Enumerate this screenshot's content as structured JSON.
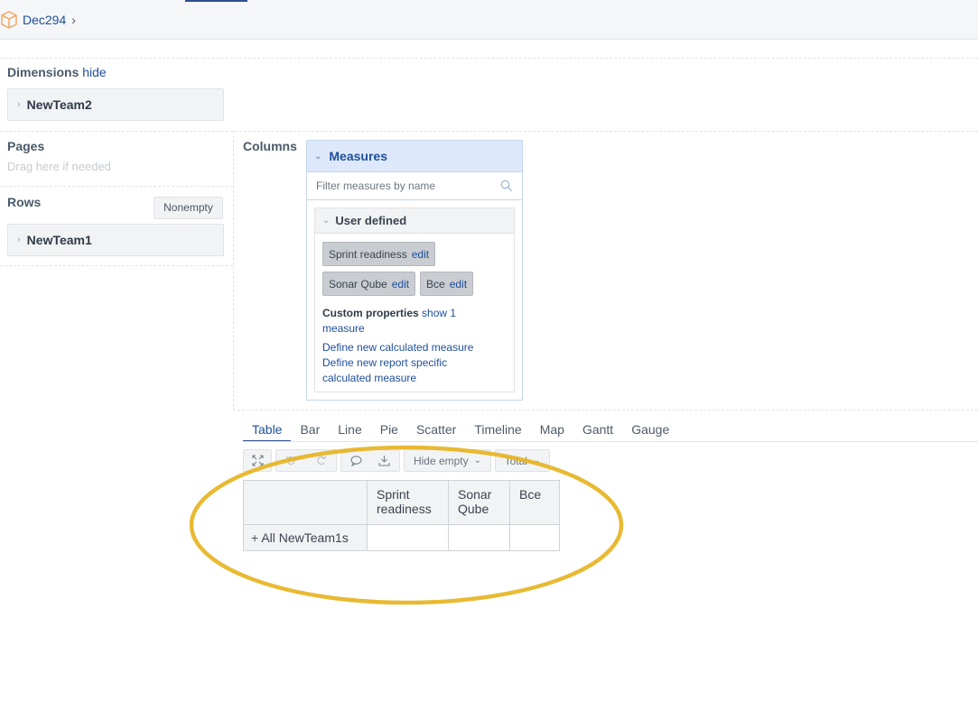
{
  "breadcrumb": {
    "label": "Dec294"
  },
  "dimensions": {
    "label": "Dimensions",
    "hide_link": "hide",
    "items": [
      {
        "label": "NewTeam2"
      }
    ]
  },
  "pages": {
    "label": "Pages",
    "hint": "Drag here if needed"
  },
  "rows": {
    "label": "Rows",
    "nonempty_button": "Nonempty",
    "items": [
      {
        "label": "NewTeam1"
      }
    ]
  },
  "columns": {
    "label": "Columns",
    "measures": {
      "title": "Measures",
      "filter_placeholder": "Filter measures by name",
      "group": {
        "title": "User defined",
        "chips": [
          {
            "label": "Sprint readiness",
            "edit": "edit"
          },
          {
            "label": "Sonar Qube",
            "edit": "edit"
          },
          {
            "label": "Bce",
            "edit": "edit"
          }
        ],
        "custom_properties_label": "Custom properties",
        "show_link": "show 1 measure",
        "define_calc": "Define new calculated measure",
        "define_report": "Define new report specific calculated measure"
      }
    }
  },
  "viz_tabs": [
    "Table",
    "Bar",
    "Line",
    "Pie",
    "Scatter",
    "Timeline",
    "Map",
    "Gantt",
    "Gauge"
  ],
  "active_viz_tab": "Table",
  "toolbar": {
    "hide_empty": "Hide empty",
    "total": "Total",
    "icons": [
      "fullscreen-icon",
      "undo-icon",
      "redo-icon",
      "comment-icon",
      "export-icon"
    ]
  },
  "result_table": {
    "headers": [
      "",
      "Sprint readiness",
      "Sonar Qube",
      "Bce"
    ],
    "rows": [
      {
        "label": "All NewTeam1s",
        "expand": "+",
        "values": [
          "",
          "",
          ""
        ]
      }
    ]
  },
  "colors": {
    "accent": "#1f4e9b",
    "highlight": "#e6b422",
    "brand_icon": "#f0a45a"
  }
}
